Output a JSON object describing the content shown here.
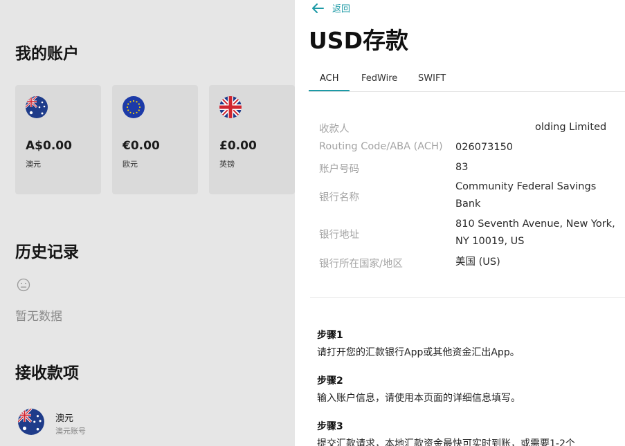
{
  "left": {
    "my_accounts_title": "我的账户",
    "accounts": [
      {
        "amount": "A$0.00",
        "currency": "澳元",
        "flag": "australia-flag-icon"
      },
      {
        "amount": "€0.00",
        "currency": "欧元",
        "flag": "eu-flag-icon"
      },
      {
        "amount": "£0.00",
        "currency": "英镑",
        "flag": "uk-flag-icon"
      }
    ],
    "history_title": "历史记录",
    "history_empty": "暂无数据",
    "receive_title": "接收款项",
    "receive_item": {
      "title": "澳元",
      "subtitle": "澳元账号",
      "flag": "australia-flag-icon"
    }
  },
  "drawer": {
    "back_label": "返回",
    "title": "USD存款",
    "tabs": [
      "ACH",
      "FedWire",
      "SWIFT"
    ],
    "active_tab": "ACH",
    "details": [
      {
        "label": "收款人",
        "value": "olding Limited"
      },
      {
        "label": "Routing Code/ABA (ACH)",
        "value": "026073150"
      },
      {
        "label": "账户号码",
        "value": "83"
      },
      {
        "label": "银行名称",
        "value_lines": [
          "Community Federal Savings",
          "Bank"
        ]
      },
      {
        "label": "银行地址",
        "value_lines": [
          "810 Seventh Avenue, New York,",
          "NY 10019, US"
        ]
      },
      {
        "label": "银行所在国家/地区",
        "value": "美国 (US)"
      }
    ],
    "steps": [
      {
        "title": "步骤1",
        "desc": "请打开您的汇款银行App或其他资金汇出App。"
      },
      {
        "title": "步骤2",
        "desc": "输入账户信息，请使用本页面的详细信息填写。"
      },
      {
        "title": "步骤3",
        "desc": "提交汇款请求，本地汇款资金最快可实时到账，或需要1-2个"
      }
    ]
  },
  "colors": {
    "accent": "#1d9aa6",
    "overlay_bg": "#e6e6e6",
    "card_bg": "#dadada"
  }
}
